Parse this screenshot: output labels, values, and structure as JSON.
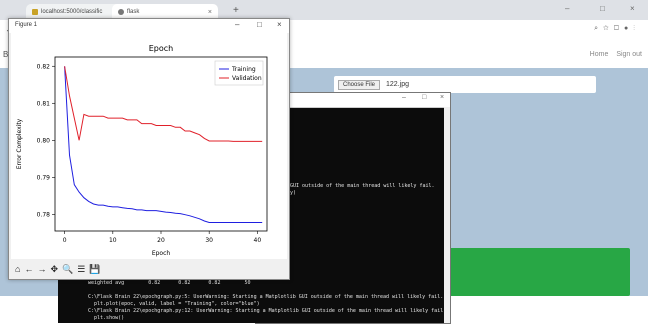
{
  "browser": {
    "tabs": [
      {
        "title": "localhost:5000/classific",
        "close": "×"
      },
      {
        "title": "flask",
        "close": "×"
      }
    ],
    "new_tab": "+",
    "window_controls": [
      "–",
      "□",
      "×"
    ],
    "back": "←"
  },
  "page": {
    "brand": "Br",
    "nav": [
      "Home",
      "Sign out"
    ],
    "choose_file_label": "Choose File",
    "file_name": "122.jpg",
    "colors": {
      "page_bg": "#aec4d8",
      "button": "#28a745"
    }
  },
  "console": {
    "controls": [
      "–",
      "□",
      "×"
    ],
    "lines_mid": [
      "GUI outside of the main thread will likely fail.",
      "y)"
    ],
    "lines_bottom": [
      "weighted avg        0.82      0.82      0.82        50",
      "",
      "C:\\Flask Brain 22\\epochgraph.py:5: UserWarning: Starting a Matplotlib GUI outside of the main thread will likely fail.",
      "  plt.plot(epoc, valid, label = \"Training\", color=\"blue\")",
      "C:\\Flask Brain 22\\epochgraph.py:12: UserWarning: Starting a Matplotlib GUI outside of the main thread will likely fail.",
      "  plt.show()"
    ]
  },
  "figure_window": {
    "title": "Figure 1",
    "controls": [
      "–",
      "□",
      "×"
    ],
    "toolbar_icons": [
      "home-icon",
      "back-icon",
      "forward-icon",
      "pan-icon",
      "zoom-icon",
      "configure-icon",
      "save-icon"
    ],
    "toolbar_glyphs": [
      "⌂",
      "←",
      "→",
      "✥",
      "🔍",
      "☰",
      "💾"
    ]
  },
  "chart_data": {
    "type": "line",
    "title": "Epoch",
    "xlabel": "Epoch",
    "ylabel": "Error Complexity",
    "xlim": [
      -2,
      42
    ],
    "ylim": [
      0.7755,
      0.8225
    ],
    "xticks": [
      0,
      10,
      20,
      30,
      40
    ],
    "yticks": [
      0.78,
      0.79,
      0.8,
      0.81,
      0.82
    ],
    "legend": "top-right",
    "series": [
      {
        "name": "Training",
        "color": "#1f1fe0",
        "x": [
          0,
          1,
          2,
          3,
          4,
          5,
          6,
          7,
          8,
          9,
          10,
          11,
          12,
          13,
          14,
          15,
          16,
          17,
          18,
          19,
          20,
          21,
          22,
          23,
          24,
          25,
          26,
          27,
          28,
          29,
          30,
          31,
          32,
          33,
          34,
          35,
          36,
          37,
          38,
          39,
          40,
          41
        ],
        "y": [
          0.82,
          0.796,
          0.788,
          0.786,
          0.7845,
          0.7835,
          0.7828,
          0.7825,
          0.7825,
          0.7822,
          0.782,
          0.782,
          0.7818,
          0.7816,
          0.7815,
          0.7812,
          0.7812,
          0.781,
          0.781,
          0.781,
          0.7808,
          0.7806,
          0.7805,
          0.7803,
          0.7802,
          0.7799,
          0.7796,
          0.7792,
          0.7788,
          0.7782,
          0.7778,
          0.7778,
          0.7778,
          0.7778,
          0.7778,
          0.7778,
          0.7778,
          0.7778,
          0.7778,
          0.7778,
          0.7778,
          0.7778
        ]
      },
      {
        "name": "Validation",
        "color": "#e0202a",
        "x": [
          0,
          1,
          2,
          3,
          4,
          5,
          6,
          7,
          8,
          9,
          10,
          11,
          12,
          13,
          14,
          15,
          16,
          17,
          18,
          19,
          20,
          21,
          22,
          23,
          24,
          25,
          26,
          27,
          28,
          29,
          30,
          31,
          32,
          33,
          34,
          35,
          36,
          37,
          38,
          39,
          40,
          41
        ],
        "y": [
          0.82,
          0.812,
          0.806,
          0.8,
          0.807,
          0.8065,
          0.8065,
          0.8065,
          0.8065,
          0.806,
          0.806,
          0.806,
          0.806,
          0.8055,
          0.8055,
          0.8055,
          0.8045,
          0.8045,
          0.8045,
          0.804,
          0.804,
          0.804,
          0.804,
          0.8035,
          0.8035,
          0.8025,
          0.8025,
          0.802,
          0.8015,
          0.8005,
          0.7998,
          0.7998,
          0.7998,
          0.7998,
          0.7998,
          0.7997,
          0.7997,
          0.7997,
          0.7997,
          0.7997,
          0.7997,
          0.7997
        ]
      }
    ]
  }
}
